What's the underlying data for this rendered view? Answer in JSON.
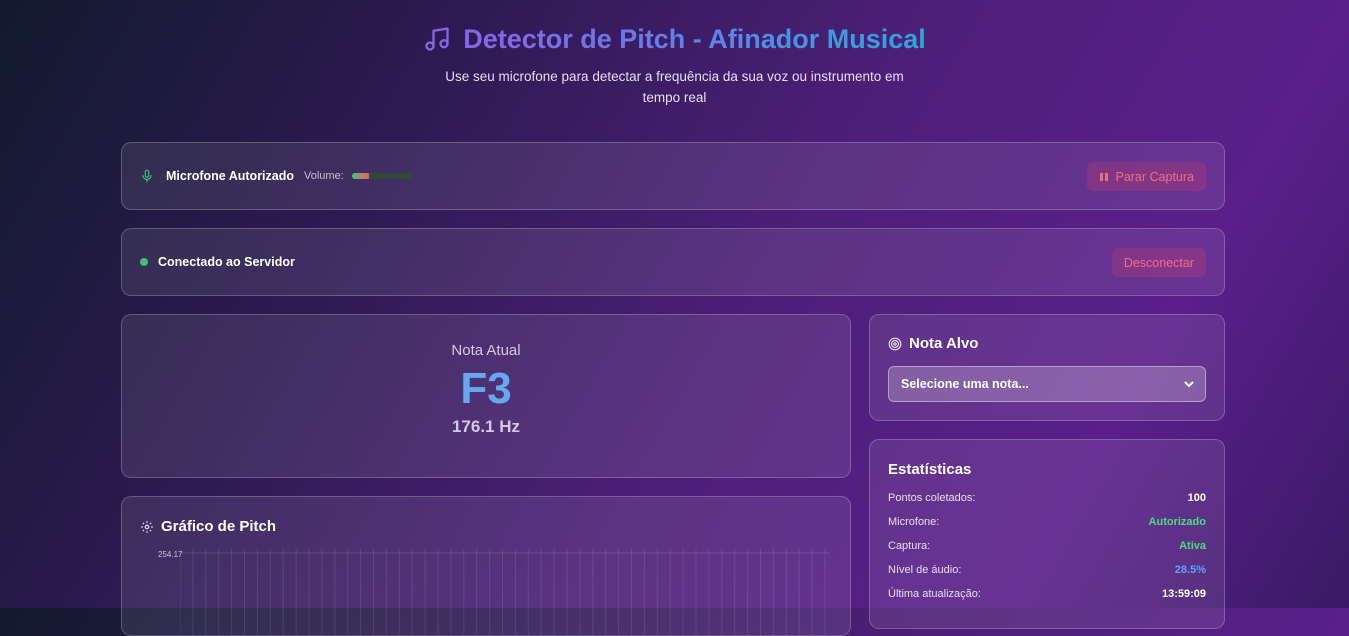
{
  "header": {
    "title": "Detector de Pitch - Afinador Musical",
    "subtitle": "Use seu microfone para detectar a frequência da sua voz ou instrumento em tempo real",
    "icon": "music-note-icon"
  },
  "mic": {
    "status": "Microfone Autorizado",
    "volume_label": "Volume:",
    "volume_level": 0.28,
    "stop_button": "Parar Captura"
  },
  "connection": {
    "status": "Conectado ao Servidor",
    "disconnect_button": "Desconectar"
  },
  "note": {
    "label": "Nota Atual",
    "value": "F3",
    "frequency": "176.1 Hz"
  },
  "target": {
    "title": "Nota Alvo",
    "select_value": "Selecione uma nota..."
  },
  "stats": {
    "title": "Estatísticas",
    "rows": [
      {
        "key": "Pontos coletados:",
        "value": "100",
        "color": "#ffffff"
      },
      {
        "key": "Microfone:",
        "value": "Autorizado",
        "color": "#4ade80"
      },
      {
        "key": "Captura:",
        "value": "Ativa",
        "color": "#4ade80"
      },
      {
        "key": "Nível de áudio:",
        "value": "28.5%",
        "color": "#60a5fa"
      },
      {
        "key": "Última atualização:",
        "value": "13:59:09",
        "color": "#ffffff"
      }
    ]
  },
  "graph": {
    "title": "Gráfico de Pitch",
    "y_max_label": "254.17"
  },
  "colors": {
    "accent_purple": "#8a63e8",
    "accent_cyan": "#2aa8d8",
    "success": "#4ade80",
    "danger": "#ef6f86",
    "note_blue": "#66a8f0"
  }
}
